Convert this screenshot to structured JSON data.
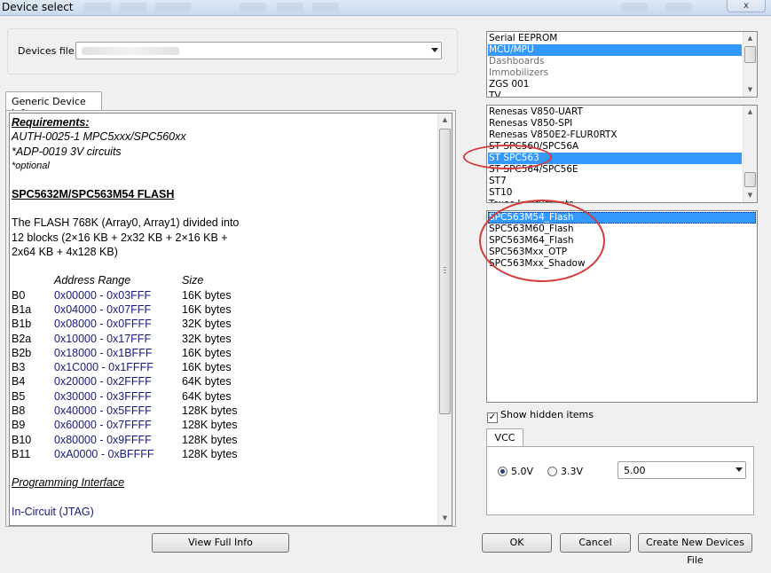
{
  "window": {
    "title": "Device select",
    "close_label": "x"
  },
  "devices_file": {
    "label": "Devices file:",
    "value": ""
  },
  "tab": {
    "label": "Generic Device Info"
  },
  "info": {
    "requirements_title": "Requirements:",
    "req_line1": "AUTH-0025-1 MPC5xxx/SPC560xx",
    "req_line2": "*ADP-0019 3V circuits",
    "req_line3": "*optional",
    "chip_title": "SPC5632M/SPC563M54 FLASH",
    "desc_line1": "The FLASH 768K (Array0, Array1) divided into",
    "desc_line2": "12 blocks (2×16 KB + 2x32 KB +  2×16 KB +",
    "desc_line3": "2x64 KB + 4x128 KB)",
    "col_address": "Address Range",
    "col_size": "Size",
    "blocks": [
      {
        "name": "B0",
        "range": "0x00000 - 0x03FFF",
        "size": "16K bytes"
      },
      {
        "name": "B1a",
        "range": "0x04000 - 0x07FFF",
        "size": "16K bytes"
      },
      {
        "name": "B1b",
        "range": "0x08000 - 0x0FFFF",
        "size": "32K bytes"
      },
      {
        "name": "B2a",
        "range": "0x10000 - 0x17FFF",
        "size": "32K bytes"
      },
      {
        "name": "B2b",
        "range": "0x18000 - 0x1BFFF",
        "size": "16K bytes"
      },
      {
        "name": "B3",
        "range": "0x1C000 - 0x1FFFF",
        "size": "16K bytes"
      },
      {
        "name": "B4",
        "range": "0x20000 - 0x2FFFF",
        "size": "64K bytes"
      },
      {
        "name": "B5",
        "range": "0x30000 - 0x3FFFF",
        "size": "64K bytes"
      },
      {
        "name": "B8",
        "range": "0x40000 - 0x5FFFF",
        "size": "128K bytes"
      },
      {
        "name": "B9",
        "range": "0x60000 - 0x7FFFF",
        "size": "128K bytes"
      },
      {
        "name": "B10",
        "range": "0x80000 - 0x9FFFF",
        "size": "128K bytes"
      },
      {
        "name": "B11",
        "range": "0xA0000 - 0xBFFFF",
        "size": "128K bytes"
      }
    ],
    "programming_interface": "Programming Interface",
    "interface_value": "In-Circuit (JTAG)"
  },
  "buttons": {
    "view_full_info": "View Full Info",
    "ok": "OK",
    "cancel": "Cancel",
    "create_new": "Create New Devices File"
  },
  "category_list": [
    {
      "label": "Serial EEPROM",
      "state": "normal"
    },
    {
      "label": "MCU/MPU",
      "state": "selected"
    },
    {
      "label": "Dashboards",
      "state": "dim"
    },
    {
      "label": "Immobilizers",
      "state": "dim"
    },
    {
      "label": "ZGS 001",
      "state": "normal"
    },
    {
      "label": "TV",
      "state": "normal"
    }
  ],
  "family_list": [
    {
      "label": "Renesas V850-UART",
      "state": "normal"
    },
    {
      "label": "Renesas V850-SPI",
      "state": "normal"
    },
    {
      "label": "Renesas V850E2-FLUR0RTX",
      "state": "normal"
    },
    {
      "label": "ST SPC560/SPC56A",
      "state": "normal"
    },
    {
      "label": "ST SPC563",
      "state": "selected"
    },
    {
      "label": "ST SPC564/SPC56E",
      "state": "normal"
    },
    {
      "label": "ST7",
      "state": "normal"
    },
    {
      "label": "ST10",
      "state": "normal"
    },
    {
      "label": "Texas Instruments",
      "state": "normal"
    }
  ],
  "device_list": [
    {
      "label": "SPC563M54_Flash",
      "state": "selected"
    },
    {
      "label": "SPC563M60_Flash",
      "state": "normal"
    },
    {
      "label": "SPC563M64_Flash",
      "state": "normal"
    },
    {
      "label": "SPC563Mxx_OTP",
      "state": "normal"
    },
    {
      "label": "SPC563Mxx_Shadow",
      "state": "normal"
    }
  ],
  "show_hidden": {
    "label": "Show hidden items",
    "checked": true,
    "check_glyph": "✓"
  },
  "vcc": {
    "tab_label": "VCC",
    "option_5v": "5.0V",
    "option_33v": "3.3V",
    "selected": "5.0V",
    "voltage_value": "5.00"
  },
  "icons": {
    "scroll_up": "▲",
    "scroll_down": "▼",
    "scroll_grip": "≡"
  }
}
